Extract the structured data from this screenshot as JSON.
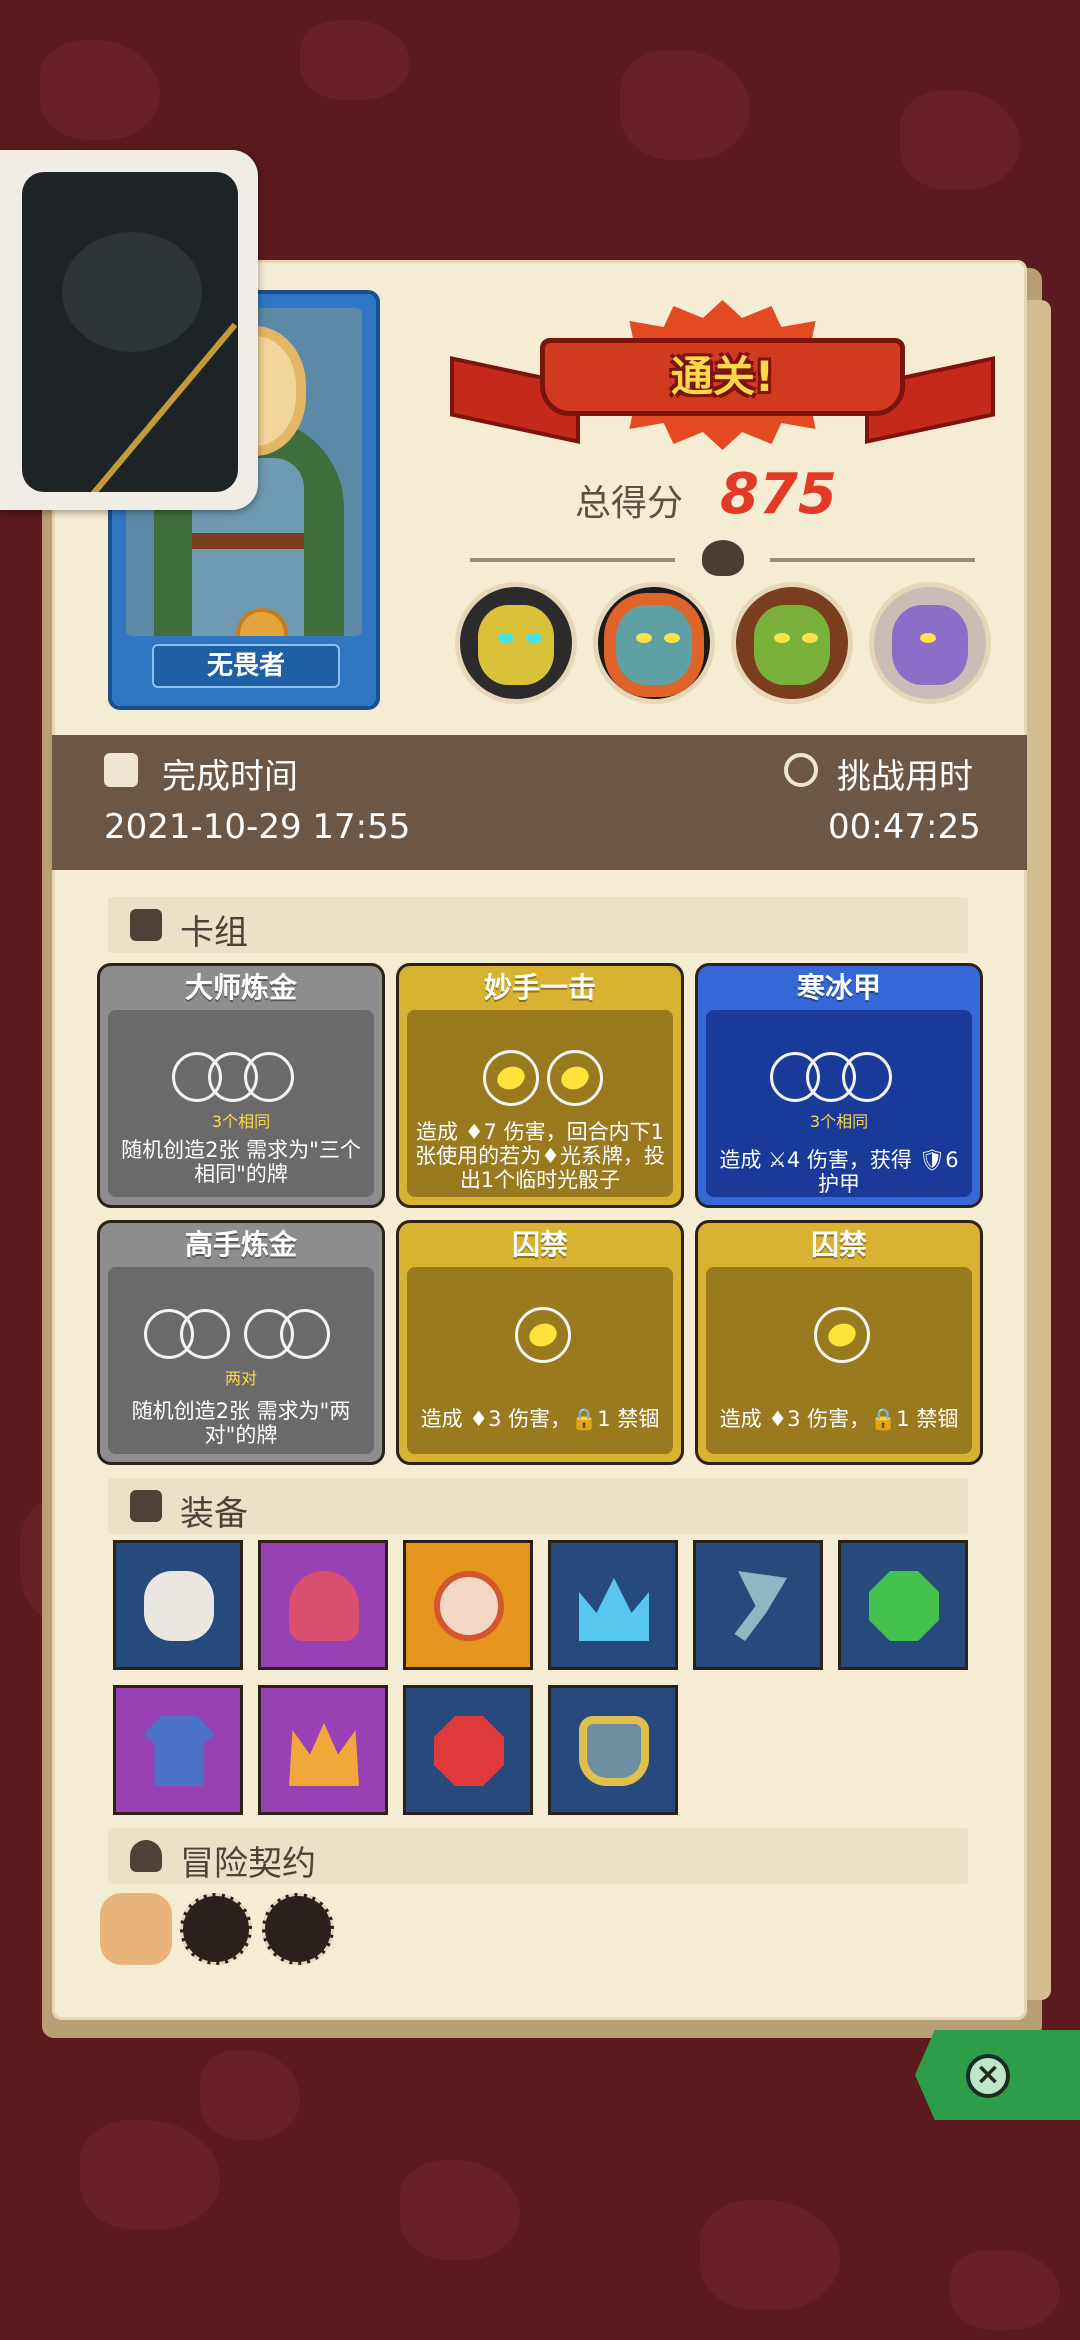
{
  "result": {
    "banner": "通关!",
    "score_label": "总得分",
    "score_value": "875"
  },
  "hero": {
    "name": "无畏者"
  },
  "bosses": [
    {
      "name": "boss-armored-knight",
      "color": "#d9c23a"
    },
    {
      "name": "boss-orange-ogre",
      "color": "#5fa0a4"
    },
    {
      "name": "boss-goblin-king",
      "color": "#79b13a"
    },
    {
      "name": "boss-purple-dragon",
      "color": "#8a6ec7"
    }
  ],
  "times": {
    "complete_label": "完成时间",
    "complete_value": "2021-10-29 17:55",
    "challenge_label": "挑战用时",
    "challenge_value": "00:47:25"
  },
  "sections": {
    "deck": "卡组",
    "equipment": "装备",
    "contract": "冒险契约"
  },
  "cards": [
    {
      "title": "大师炼金",
      "style": "gray",
      "caption": "3个相同",
      "desc": "随机创造2张 需求为\"三个相同\"的牌"
    },
    {
      "title": "妙手一击",
      "style": "gold",
      "caption": "",
      "desc": "造成 ♦7 伤害，回合内下1张使用的若为♦光系牌，投出1个临时光骰子"
    },
    {
      "title": "寒冰甲",
      "style": "blue",
      "caption": "3个相同",
      "desc": "造成 ⚔4 伤害，获得 🛡6 护甲"
    },
    {
      "title": "高手炼金",
      "style": "gray",
      "caption": "两对",
      "desc": "随机创造2张 需求为\"两对\"的牌"
    },
    {
      "title": "囚禁",
      "style": "gold",
      "caption": "",
      "desc": "造成 ♦3 伤害，🔒1 禁锢"
    },
    {
      "title": "囚禁",
      "style": "gold",
      "caption": "",
      "desc": "造成 ♦3 伤害，🔒1 禁锢"
    }
  ],
  "equipment": [
    {
      "icon": "horned-skull-icon",
      "bg": "navy"
    },
    {
      "icon": "mushroom-cap-icon",
      "bg": "purple"
    },
    {
      "icon": "target-shield-icon",
      "bg": "orange"
    },
    {
      "icon": "ice-crown-icon",
      "bg": "navy"
    },
    {
      "icon": "scythe-icon",
      "bg": "navy"
    },
    {
      "icon": "emerald-gem-icon",
      "bg": "navy"
    },
    {
      "icon": "blue-tunic-icon",
      "bg": "purple"
    },
    {
      "icon": "gold-crown-icon",
      "bg": "purple"
    },
    {
      "icon": "ruby-gem-icon",
      "bg": "navy"
    },
    {
      "icon": "compass-armor-icon",
      "bg": "navy"
    }
  ],
  "contracts": [
    {
      "icon": "scroll-icon"
    },
    {
      "icon": "golden-totem-icon"
    },
    {
      "icon": "green-dagger-icon"
    }
  ]
}
